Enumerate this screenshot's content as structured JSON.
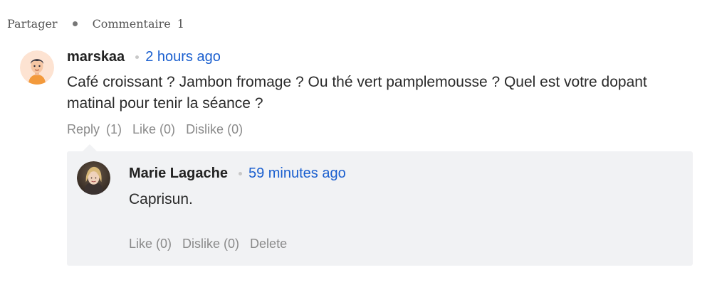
{
  "share_bar": {
    "share_label": "Partager",
    "comment_label": "Commentaire",
    "comment_count": "1"
  },
  "comments": [
    {
      "author": "marskaa",
      "time": "2 hours ago",
      "text": "Café croissant ? Jambon fromage ? Ou thé vert pamplemousse ? Quel est votre dopant matinal pour tenir la séance ?",
      "actions": {
        "reply_label": "Reply",
        "reply_count": "(1)",
        "like_label": "Like (0)",
        "dislike_label": "Dislike (0)"
      },
      "avatar_icon": "cartoon-user-avatar"
    }
  ],
  "reply": {
    "author": "Marie Lagache",
    "time": "59 minutes ago",
    "text": "Caprisun.",
    "actions": {
      "like_label": "Like (0)",
      "dislike_label": "Dislike (0)",
      "delete_label": "Delete"
    },
    "avatar_icon": "photo-user-avatar"
  },
  "colors": {
    "link": "#1a5fcf",
    "muted": "#8a8a8a",
    "reply_bg": "#f1f2f4"
  }
}
